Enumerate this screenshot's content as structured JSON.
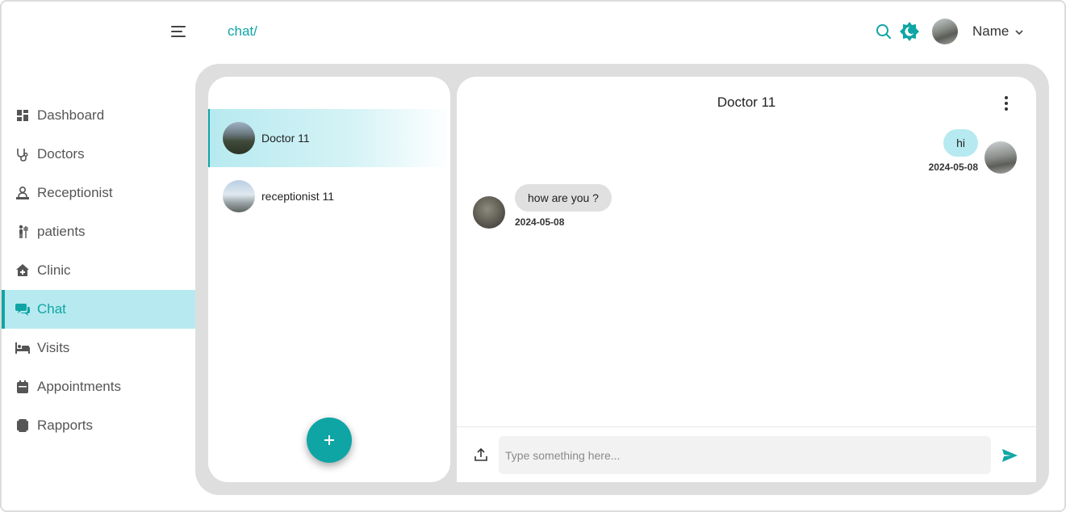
{
  "header": {
    "breadcrumb": "chat/",
    "user_name": "Name",
    "icons": [
      "menu-icon",
      "search-icon",
      "theme-toggle-icon",
      "chevron-down-icon"
    ]
  },
  "sidebar": {
    "items": [
      {
        "label": "Dashboard",
        "icon": "dashboard-icon",
        "active": false
      },
      {
        "label": "Doctors",
        "icon": "stethoscope-icon",
        "active": false
      },
      {
        "label": "Receptionist",
        "icon": "receptionist-icon",
        "active": false
      },
      {
        "label": "patients",
        "icon": "patient-icon",
        "active": false
      },
      {
        "label": "Clinic",
        "icon": "clinic-icon",
        "active": false
      },
      {
        "label": "Chat",
        "icon": "chat-icon",
        "active": true
      },
      {
        "label": "Visits",
        "icon": "bed-icon",
        "active": false
      },
      {
        "label": "Appointments",
        "icon": "calendar-icon",
        "active": false
      },
      {
        "label": "Rapports",
        "icon": "report-icon",
        "active": false
      }
    ]
  },
  "conversations": [
    {
      "name": "Doctor 11",
      "active": true
    },
    {
      "name": "receptionist 11",
      "active": false
    }
  ],
  "chat": {
    "title": "Doctor 11",
    "messages": [
      {
        "direction": "outgoing",
        "text": "hi",
        "date": "2024-05-08"
      },
      {
        "direction": "incoming",
        "text": "how are you ?",
        "date": "2024-05-08"
      }
    ],
    "input_placeholder": "Type something here...",
    "input_value": ""
  },
  "colors": {
    "accent": "#10a5a5",
    "active_bg": "#b6eaf0",
    "panel_bg": "#dedede",
    "incoming_bubble": "#e0e0e0"
  }
}
